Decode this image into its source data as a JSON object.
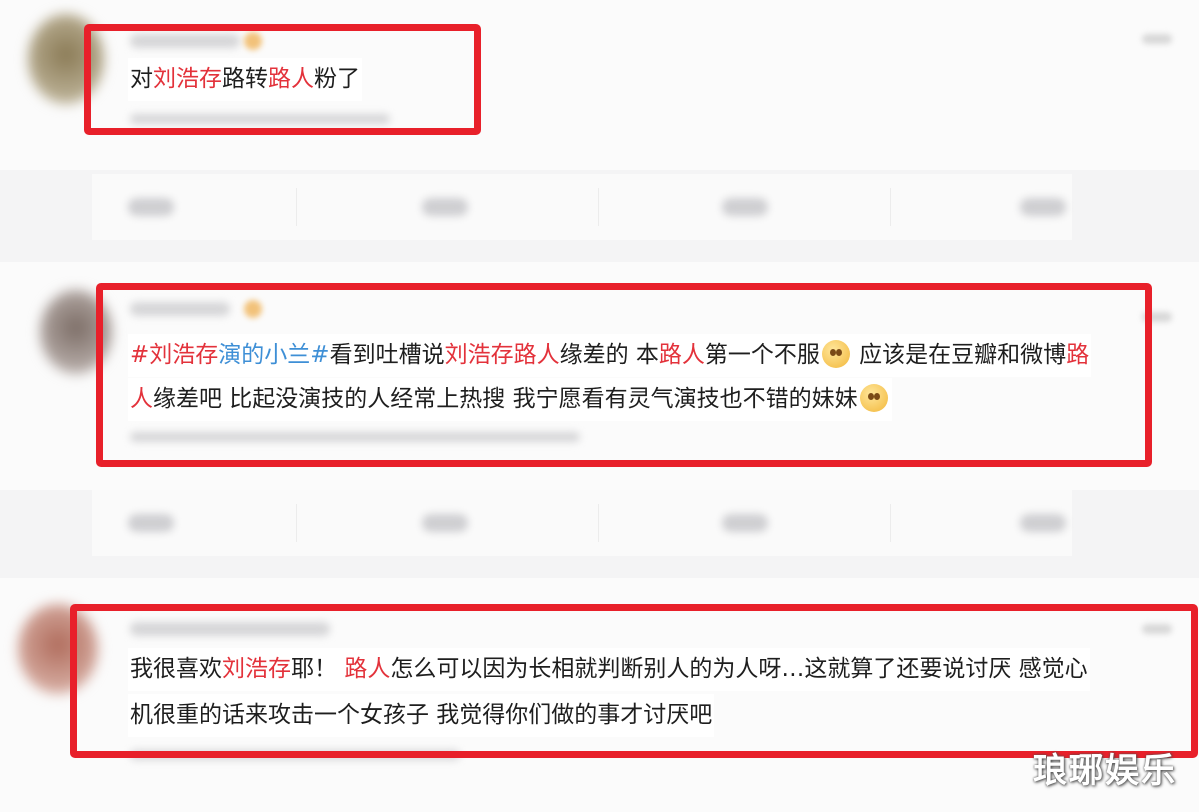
{
  "comments": [
    {
      "segments": [
        {
          "text": "对",
          "style": "plain"
        },
        {
          "text": "刘浩存",
          "style": "highlight"
        },
        {
          "text": "路转",
          "style": "plain"
        },
        {
          "text": "路人",
          "style": "highlight"
        },
        {
          "text": "粉了",
          "style": "plain"
        }
      ]
    },
    {
      "line1": [
        {
          "text": "#刘浩存",
          "style": "highlight-tag"
        },
        {
          "text": "演的小兰#",
          "style": "tag"
        },
        {
          "text": "看到吐槽说",
          "style": "plain"
        },
        {
          "text": "刘浩存",
          "style": "highlight"
        },
        {
          "text": "路人",
          "style": "highlight"
        },
        {
          "text": "缘差的 本",
          "style": "plain"
        },
        {
          "text": "路人",
          "style": "highlight"
        },
        {
          "text": "第一个不服",
          "style": "plain"
        },
        {
          "text": "",
          "style": "emoji"
        },
        {
          "text": " 应该是在豆瓣和微博",
          "style": "plain"
        },
        {
          "text": "路",
          "style": "highlight"
        }
      ],
      "line2": [
        {
          "text": "人",
          "style": "highlight"
        },
        {
          "text": "缘差吧 比起没演技的人经常上热搜 我宁愿看有灵气演技也不错的妹妹",
          "style": "plain"
        },
        {
          "text": "",
          "style": "emoji"
        }
      ]
    },
    {
      "line1": [
        {
          "text": "我很喜欢",
          "style": "plain"
        },
        {
          "text": "刘浩存",
          "style": "highlight"
        },
        {
          "text": "耶！ ",
          "style": "plain"
        },
        {
          "text": "路人",
          "style": "highlight"
        },
        {
          "text": "怎么可以因为长相就判断别人的为人呀…这就算了还要说讨厌 感觉心",
          "style": "plain"
        }
      ],
      "line2": [
        {
          "text": "机很重的话来攻击一个女孩子 我觉得你们做的事才讨厌吧",
          "style": "plain"
        }
      ]
    }
  ],
  "watermark": "琅琊娱乐",
  "colors": {
    "highlight": "#e3323b",
    "tag": "#3e8fd6",
    "frame": "#e8202a"
  }
}
